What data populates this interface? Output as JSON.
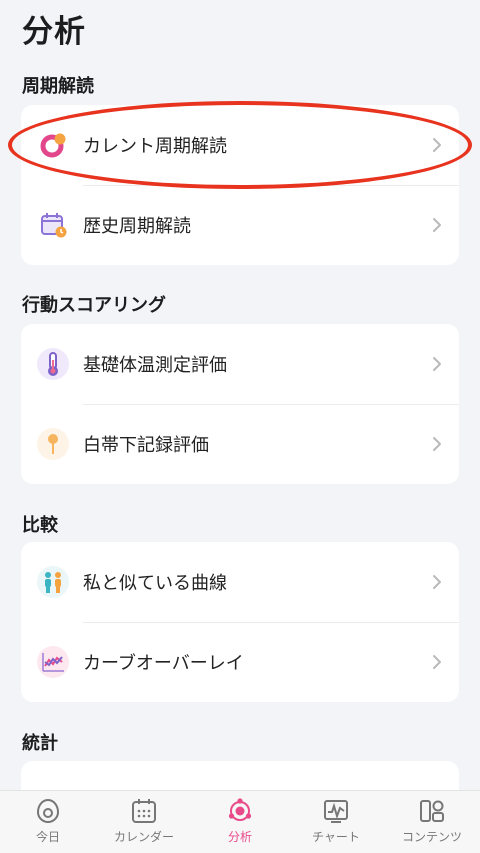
{
  "page": {
    "title": "分析"
  },
  "sections": [
    {
      "title": "周期解読",
      "items": [
        {
          "label": "カレント周期解読",
          "icon": "current-cycle-icon"
        },
        {
          "label": "歴史周期解読",
          "icon": "calendar-history-icon"
        }
      ]
    },
    {
      "title": "行動スコアリング",
      "items": [
        {
          "label": "基礎体温測定評価",
          "icon": "thermometer-icon"
        },
        {
          "label": "白帯下記録評価",
          "icon": "drop-pin-icon"
        }
      ]
    },
    {
      "title": "比較",
      "items": [
        {
          "label": "私と似ている曲線",
          "icon": "people-icon"
        },
        {
          "label": "カーブオーバーレイ",
          "icon": "curve-overlay-icon"
        }
      ]
    },
    {
      "title": "統計",
      "items": []
    }
  ],
  "tabbar": {
    "tabs": [
      {
        "label": "今日",
        "icon": "today-icon",
        "active": false
      },
      {
        "label": "カレンダー",
        "icon": "calendar-icon",
        "active": false
      },
      {
        "label": "分析",
        "icon": "analysis-icon",
        "active": true
      },
      {
        "label": "チャート",
        "icon": "chart-icon",
        "active": false
      },
      {
        "label": "コンテンツ",
        "icon": "content-icon",
        "active": false
      }
    ]
  },
  "colors": {
    "accent": "#e94b8a",
    "highlight": "#e8331f",
    "background": "#f2f4f7"
  }
}
